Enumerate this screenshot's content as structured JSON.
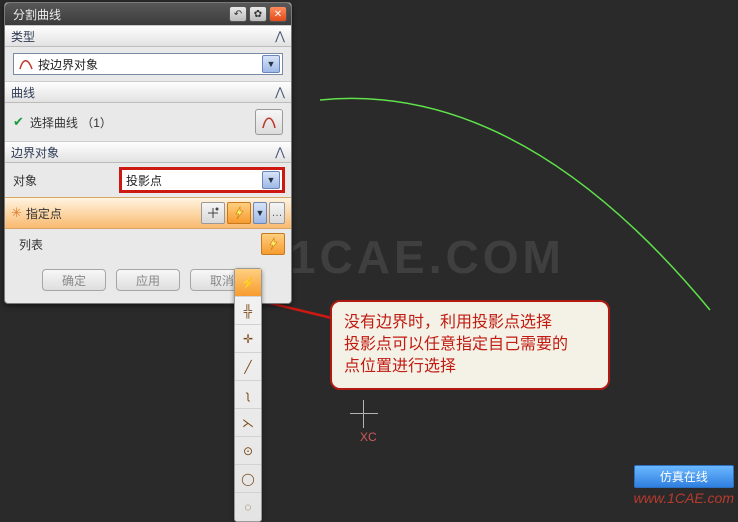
{
  "window": {
    "title": "分割曲线",
    "icons": {
      "undo": "↶",
      "gear": "✿",
      "close": "✕"
    }
  },
  "sections": {
    "type": {
      "header": "类型",
      "dropdown_icon": "S",
      "dropdown_value": "按边界对象"
    },
    "curve": {
      "header": "曲线",
      "select_label": "选择曲线 （1）"
    },
    "boundary": {
      "header": "边界对象",
      "object_label": "对象",
      "object_value": "投影点",
      "point_label": "指定点",
      "list_label": "列表"
    }
  },
  "footer": {
    "ok": "确定",
    "apply": "应用",
    "cancel": "取消"
  },
  "point_methods": [
    {
      "name": "auto-infer-icon",
      "glyph": "⚡",
      "active": true
    },
    {
      "name": "cursor-point-icon",
      "glyph": "╬",
      "active": false
    },
    {
      "name": "existing-point-icon",
      "glyph": "✛",
      "active": false
    },
    {
      "name": "end-point-icon",
      "glyph": "╱",
      "active": false
    },
    {
      "name": "control-point-icon",
      "glyph": "ʅ",
      "active": false
    },
    {
      "name": "intersection-icon",
      "glyph": "⋋",
      "active": false
    },
    {
      "name": "arc-center-icon",
      "glyph": "⊙",
      "active": false
    },
    {
      "name": "point-on-curve-icon",
      "glyph": "◯",
      "active": false
    },
    {
      "name": "quadrant-icon",
      "glyph": "◌",
      "active": false
    }
  ],
  "viewport": {
    "watermark": "1CAE.COM",
    "axis_x": "XC"
  },
  "annotation": {
    "line1": "没有边界时，利用投影点选择",
    "line2": "投影点可以任意指定自己需要的",
    "line3": "点位置进行选择"
  },
  "stamp": {
    "brand": "仿真在线",
    "url": "www.1CAE.com"
  }
}
